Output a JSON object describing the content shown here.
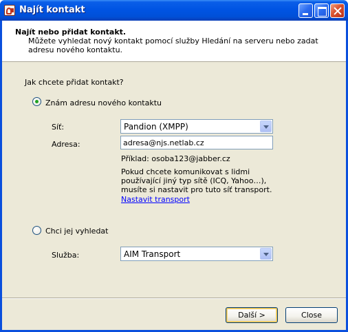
{
  "window": {
    "title": "Najít kontakt"
  },
  "header": {
    "title": "Najít nebo přidat kontakt.",
    "description": "Můžete vyhledat nový kontakt pomocí služby Hledání na serveru nebo zadat adresu nového kontaktu."
  },
  "form": {
    "question": "Jak chcete přidat kontakt?",
    "option_known": {
      "label": "Znám adresu nového kontaktu",
      "checked": true
    },
    "network": {
      "label": "Síť:",
      "value": "Pandion (XMPP)"
    },
    "address": {
      "label": "Adresa:",
      "value": "adresa@njs.netlab.cz"
    },
    "example": "Příklad: osoba123@jabber.cz",
    "info": "Pokud chcete komunikovat s lidmi používající jiný typ sítě (ICQ, Yahoo…), musíte si nastavit pro tuto síť transport.",
    "transport_link": "Nastavit transport",
    "option_search": {
      "label": "Chci jej vyhledat",
      "checked": false
    },
    "service": {
      "label": "Služba:",
      "value": "AIM Transport"
    }
  },
  "buttons": {
    "next": "Další >",
    "close": "Close"
  },
  "colors": {
    "titlebar": "#0054e3",
    "dialog_bg": "#ece9d8",
    "link": "#0000ff"
  }
}
